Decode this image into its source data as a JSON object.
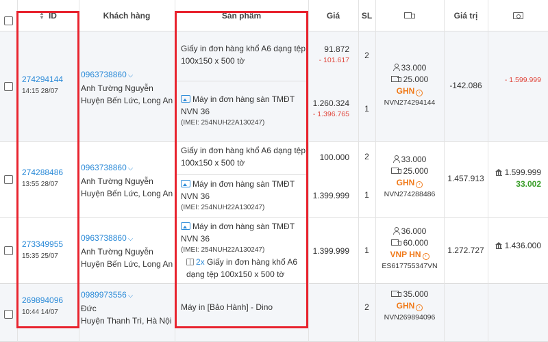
{
  "header": {
    "id": "ID",
    "customer": "Khách hàng",
    "product": "Sản phẩm",
    "price": "Giá",
    "qty": "SL",
    "value": "Giá trị"
  },
  "icons": {
    "sort": "sort-icon",
    "shipping": "truck-icon",
    "payment": "cash-icon",
    "product_image": "image-icon",
    "gift": "gift-icon",
    "person": "person-icon",
    "bank": "bank-icon"
  },
  "colors": {
    "link": "#2c8bd8",
    "negative": "#e0463c",
    "carrier": "#f07a1a",
    "positive": "#3a9e2a",
    "highlight_box": "#e8232e"
  },
  "orders": [
    {
      "id": "274294144",
      "time": "14:15 28/07",
      "phone": "0963738860",
      "name": "Anh Tường Nguyễn",
      "address": "Huyện Bến Lức, Long An",
      "items": [
        {
          "name": "Giấy in đơn hàng khổ A6 dạng tệp 100x150 x 500 tờ",
          "price": "91.872",
          "discount": "- 101.617",
          "qty": "2"
        },
        {
          "name": "Máy in đơn hàng sàn TMĐT NVN 36",
          "imei": "(IMEI: 254NUH22A130247)",
          "price": "1.260.324",
          "discount": "- 1.396.765",
          "qty": "1"
        }
      ],
      "ship_fee": "33.000",
      "ship_cost": "25.000",
      "carrier": "GHN",
      "tracking": "NVN274294144",
      "value": "-142.086",
      "paid": "- 1.599.999"
    },
    {
      "id": "274288486",
      "time": "13:55 28/07",
      "phone": "0963738860",
      "name": "Anh Tường Nguyễn",
      "address": "Huyện Bến Lức, Long An",
      "items": [
        {
          "name": "Giấy in đơn hàng khổ A6 dạng tệp 100x150 x 500 tờ",
          "price": "100.000",
          "qty": "2"
        },
        {
          "name": "Máy in đơn hàng sàn TMĐT NVN 36",
          "imei": "(IMEI: 254NUH22A130247)",
          "price": "1.399.999",
          "qty": "1"
        }
      ],
      "ship_fee": "33.000",
      "ship_cost": "25.000",
      "carrier": "GHN",
      "tracking": "NVN274288486",
      "value": "1.457.913",
      "paid": "1.599.999",
      "paid_extra": "33.002"
    },
    {
      "id": "273349955",
      "time": "15:35 25/07",
      "phone": "0963738860",
      "name": "Anh Tường Nguyễn",
      "address": "Huyện Bến Lức, Long An",
      "items": [
        {
          "name": "Máy in đơn hàng sàn TMĐT NVN 36",
          "imei": "(IMEI: 254NUH22A130247)",
          "gift_qty": "2x",
          "gift_name": "Giấy in đơn hàng khổ A6 dạng tệp 100x150 x 500 tờ",
          "price": "1.399.999",
          "qty": "1"
        }
      ],
      "ship_fee": "36.000",
      "ship_cost": "60.000",
      "carrier": "VNP HN",
      "tracking": "ES617755347VN",
      "value": "1.272.727",
      "paid": "1.436.000"
    },
    {
      "id": "269894096",
      "time": "10:44 14/07",
      "phone": "0989973556",
      "name": "Đức",
      "address": "Huyện Thanh Trì, Hà Nội",
      "items": [
        {
          "name": "Máy in [Bảo Hành] - Dino",
          "qty": "2"
        }
      ],
      "ship_cost": "35.000",
      "carrier": "GHN",
      "tracking": "NVN269894096"
    }
  ]
}
